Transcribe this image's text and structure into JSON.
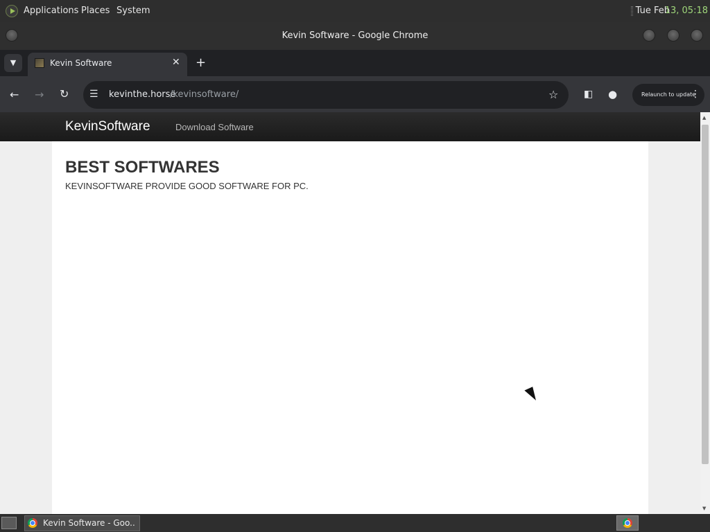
{
  "desktop_panel": {
    "menus": [
      "Applications",
      "Places",
      "System"
    ],
    "clock_date": "Tue Feb",
    "clock_time": "13, 05:18"
  },
  "window": {
    "title": "Kevin Software - Google Chrome"
  },
  "tabs": [
    {
      "title": "Kevin Software",
      "active": true
    }
  ],
  "toolbar": {
    "url_host": "kevinthe.horse",
    "url_path": "/kevinsoftware/",
    "relaunch_label": "Relaunch to update"
  },
  "site": {
    "brand": "KevinSoftware",
    "nav_link": "Download Software",
    "hero_title": "BEST SOFTWARES",
    "hero_subtitle": "KEVINSOFTWARE PROVIDE GOOD SOFTWARE FOR PC."
  },
  "taskbar": {
    "task_label": "Kevin Software - Goo..."
  },
  "icons": {
    "tab_close": "close-icon",
    "new_tab": "plus-icon",
    "back": "arrow-left-icon",
    "forward": "arrow-right-icon",
    "reload": "reload-icon",
    "site_info": "tune-icon",
    "bookmark": "star-icon",
    "side_panel": "side-panel-icon",
    "profile": "profile-icon",
    "menu": "kebab-icon"
  },
  "colors": {
    "chrome_dark": "#35363a",
    "tab_strip": "#202124",
    "site_nav": "#222222",
    "clock_accent": "#9fd67a"
  }
}
